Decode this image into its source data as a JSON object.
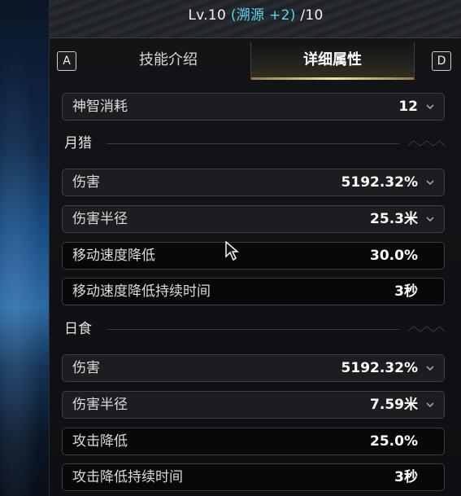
{
  "header": {
    "level_text": "Lv.10",
    "boost_text": "(溯源 +2)",
    "max_text": "/10"
  },
  "tabs": {
    "left_key": "A",
    "right_key": "D",
    "items": [
      {
        "label": "技能介绍",
        "active": false
      },
      {
        "label": "详细属性",
        "active": true
      }
    ]
  },
  "top_rows": [
    {
      "label": "神智消耗",
      "value": "12",
      "expandable": true
    }
  ],
  "sections": [
    {
      "title": "月猎",
      "rows": [
        {
          "label": "伤害",
          "value": "5192.32%",
          "expandable": true
        },
        {
          "label": "伤害半径",
          "value": "25.3米",
          "expandable": true
        },
        {
          "label": "移动速度降低",
          "value": "30.0%",
          "expandable": false
        },
        {
          "label": "移动速度降低持续时间",
          "value": "3秒",
          "expandable": false
        }
      ]
    },
    {
      "title": "日食",
      "rows": [
        {
          "label": "伤害",
          "value": "5192.32%",
          "expandable": true
        },
        {
          "label": "伤害半径",
          "value": "7.59米",
          "expandable": true
        },
        {
          "label": "攻击降低",
          "value": "25.0%",
          "expandable": false
        },
        {
          "label": "攻击降低持续时间",
          "value": "3秒",
          "expandable": false
        }
      ]
    }
  ],
  "colors": {
    "boost": "#5ed6f0",
    "tab_underline": "#f3e2a8"
  },
  "icons": {
    "expand": "chevron-down-icon",
    "cursor": "mouse-cursor-icon"
  }
}
